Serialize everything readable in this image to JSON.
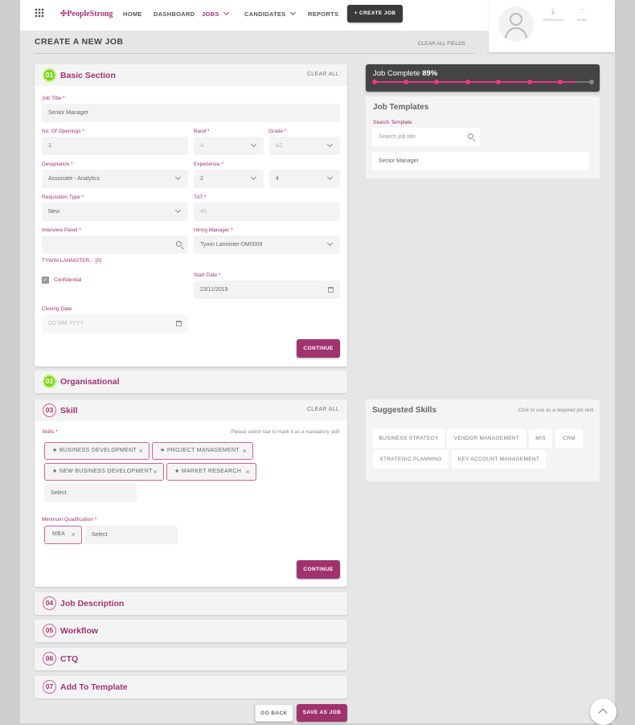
{
  "header": {
    "logo": "PeopleStrong",
    "nav": [
      {
        "label": "HOME"
      },
      {
        "label": "DASHBOARD"
      },
      {
        "label": "JOBS",
        "active": true
      },
      {
        "label": "CANDIDATES"
      },
      {
        "label": "REPORTS"
      }
    ],
    "create_job": "+ CREATE JOB",
    "downloads": "DOWNLOADS",
    "more": "MORE"
  },
  "page": {
    "title": "CREATE A NEW JOB",
    "clear_all_fields": "CLEAR ALL FIELDS"
  },
  "basic": {
    "num": "01",
    "title": "Basic Section",
    "clear": "CLEAR ALL",
    "job_title_label": "Job Title *",
    "job_title": "Senior Manager",
    "openings_label": "No. Of Openings *",
    "openings": "1",
    "band_label": "Band *",
    "band": "A",
    "grade_label": "Grade *",
    "grade": "A2",
    "designation_label": "Designation *",
    "designation": "Associate - Analytics",
    "experience_label": "Experience *",
    "exp_min": "2",
    "exp_max": "4",
    "req_type_label": "Requisition Type *",
    "req_type": "New",
    "tat_label": "TAT *",
    "tat": "45",
    "panel_label": "Interview Panel *",
    "panel_value": "",
    "hiring_label": "Hiring Manager *",
    "hiring": "Tywin Lannister-DM0009",
    "panel_chip": "TYWIN LANNISTER... [X]",
    "confidential": "Confidential",
    "confidential_checked": true,
    "start_label": "Start Date *",
    "start": "23/11/2019",
    "closing_label": "Closing Date",
    "closing_placeholder": "DD MM YYYY",
    "continue": "CONTINUE"
  },
  "org": {
    "num": "02",
    "title": "Organisational"
  },
  "skill": {
    "num": "03",
    "title": "Skill",
    "clear": "CLEAR ALL",
    "skills_label": "Skills *",
    "hint": "Please select star to mark it as a mandatory skill",
    "skills": [
      "BUSINESS DEVELOPMENT",
      "PROJECT MANAGEMENT",
      "NEW BUSINESS DEVELOPMENT",
      "MARKET RESEARCH"
    ],
    "select": "Select",
    "qual_label": "Minimum Qualification *",
    "quals": [
      "MBA"
    ],
    "qual_select": "Select",
    "continue": "CONTINUE"
  },
  "sections": [
    {
      "num": "04",
      "title": "Job Description"
    },
    {
      "num": "05",
      "title": "Workflow"
    },
    {
      "num": "06",
      "title": "CTQ"
    },
    {
      "num": "07",
      "title": "Add To Template"
    }
  ],
  "footer": {
    "go_back": "GO BACK",
    "save": "SAVE AS JOB"
  },
  "progress": {
    "label": "Job Complete",
    "percent": "89%",
    "steps_total": 8,
    "steps_done": 7,
    "color": "#f0367e"
  },
  "templates": {
    "title": "Job Templates",
    "search_label": "Search Template",
    "search_placeholder": "Search job title",
    "results": [
      "Senior Manager"
    ]
  },
  "suggested": {
    "title": "Suggested Skills",
    "hint": "Click to use as a required job skill",
    "skills": [
      "BUSINESS STRATEGY",
      "VENDOR MANAGEMENT",
      "MIS",
      "CRM",
      "STRATEGIC PLANNING",
      "KEY ACCOUNT MANAGEMENT"
    ]
  },
  "colors": {
    "brand": "#a0336f",
    "accent": "#f0367e",
    "dark": "#3a3a3a",
    "success": "#7ed321"
  }
}
